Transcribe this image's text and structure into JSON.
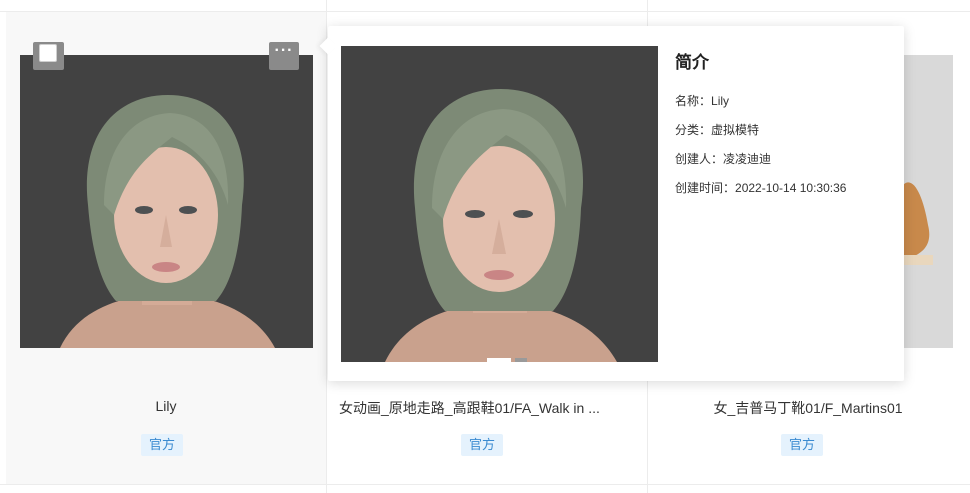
{
  "cards": [
    {
      "title": "Lily",
      "tag": "官方"
    },
    {
      "title": "女动画_原地走路_高跟鞋01/FA_Walk in ...",
      "tag": "官方"
    },
    {
      "title": "女_吉普马丁靴01/F_Martins01",
      "tag": "官方"
    }
  ],
  "popover": {
    "heading": "简介",
    "rows": [
      {
        "label": "名称：",
        "value": "Lily"
      },
      {
        "label": "分类：",
        "value": "虚拟模特"
      },
      {
        "label": "创建人：",
        "value": "凌凌迪迪"
      },
      {
        "label": "创建时间：",
        "value": "2022-10-14 10:30:36"
      }
    ]
  },
  "colors": {
    "tag_text": "#3b8bd1",
    "tag_bg": "#e5f2fd",
    "thumb_bg": "#424242"
  },
  "icons": {
    "more": "ellipsis-icon",
    "checkbox": "checkbox-icon"
  }
}
